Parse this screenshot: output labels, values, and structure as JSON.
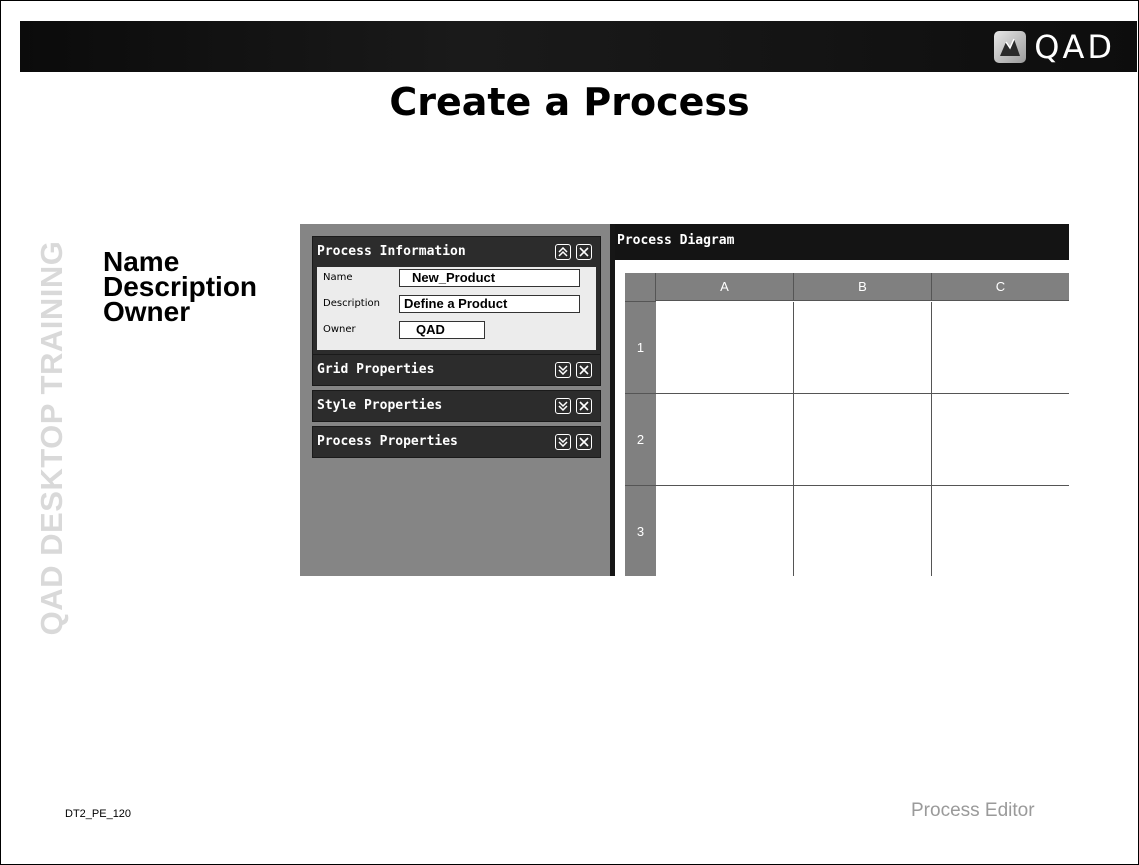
{
  "slide": {
    "title": "Create a Process",
    "side_label": "QAD DESKTOP TRAINING",
    "logo_text": "QAD",
    "bullets": [
      "Name",
      "Description",
      "Owner"
    ],
    "footer_code": "DT2_PE_120",
    "footer_section": "Process Editor"
  },
  "app": {
    "panels": [
      {
        "title": "Process Information",
        "collapse_icon": "chevron-up-icon"
      },
      {
        "title": "Grid Properties",
        "collapse_icon": "chevron-down-icon"
      },
      {
        "title": "Style Properties",
        "collapse_icon": "chevron-down-icon"
      },
      {
        "title": "Process Properties",
        "collapse_icon": "chevron-down-icon"
      }
    ],
    "fields": {
      "name": {
        "label": "Name",
        "value": "New_Product"
      },
      "description": {
        "label": "Description",
        "value": "Define a Product"
      },
      "owner": {
        "label": "Owner",
        "value": "QAD"
      }
    },
    "diagram": {
      "title": "Process Diagram",
      "columns": [
        "A",
        "B",
        "C"
      ],
      "rows": [
        "1",
        "2",
        "3"
      ]
    }
  },
  "colors": {
    "header_dark": "#141414",
    "pane_gray": "#858585",
    "side_label": "#d9d9d9",
    "footer_text": "#9a9a9a"
  }
}
